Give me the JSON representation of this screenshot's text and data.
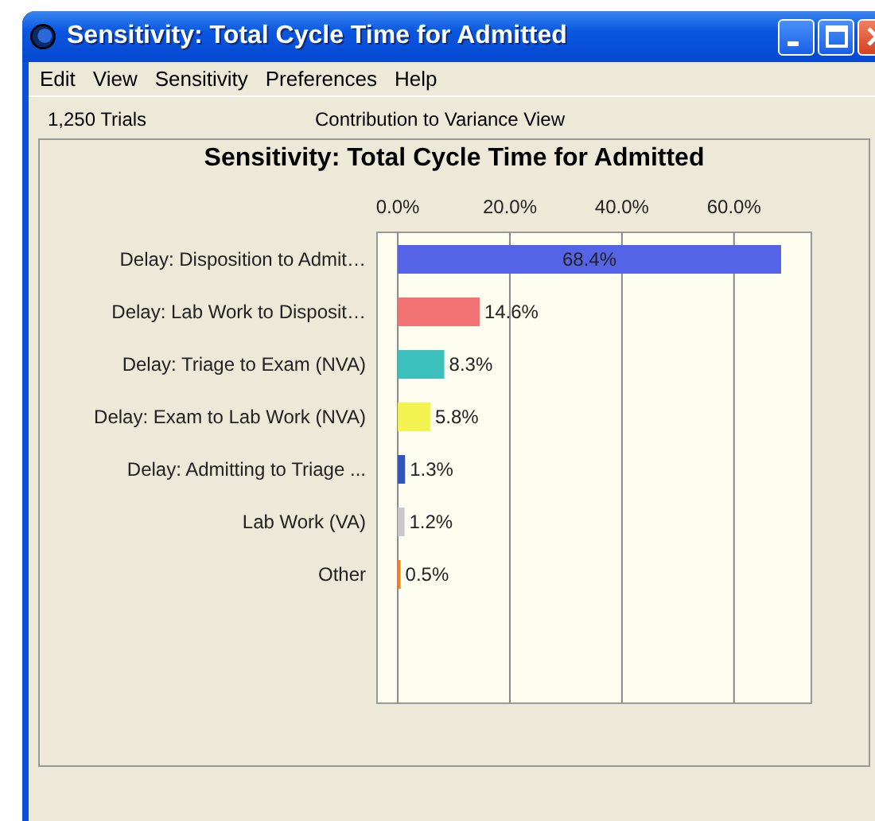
{
  "window": {
    "title": "Sensitivity: Total Cycle Time for Admitted"
  },
  "menu": [
    "Edit",
    "View",
    "Sensitivity",
    "Preferences",
    "Help"
  ],
  "info": {
    "trials": "1,250 Trials",
    "view": "Contribution to Variance View"
  },
  "chart": {
    "chart_data": {
      "type": "bar",
      "orientation": "horizontal",
      "title": "Sensitivity: Total Cycle Time for Admitted",
      "grid": true,
      "categories": [
        "Delay: Disposition to Admit…",
        "Delay: Lab Work to Disposit…",
        "Delay: Triage to Exam (NVA)",
        "Delay: Exam to Lab Work (NVA)",
        "Delay: Admitting to Triage ...",
        "Lab Work (VA)",
        "Other"
      ],
      "values": [
        68.4,
        14.6,
        8.3,
        5.8,
        1.3,
        1.2,
        0.5
      ],
      "colors": [
        "#5563e6",
        "#f07272",
        "#3cc0bc",
        "#f2f250",
        "#3355bb",
        "#c8c8c8",
        "#f08020"
      ],
      "value_labels": [
        "68.4%",
        "14.6%",
        "8.3%",
        "5.8%",
        "1.3%",
        "1.2%",
        "0.5%"
      ],
      "xlim": [
        -3.7,
        73.8
      ],
      "xticks": [
        {
          "value": 0,
          "label": "0.0%"
        },
        {
          "value": 20,
          "label": "20.0%"
        },
        {
          "value": 40,
          "label": "40.0%"
        },
        {
          "value": 60,
          "label": "60.0%"
        }
      ]
    }
  }
}
